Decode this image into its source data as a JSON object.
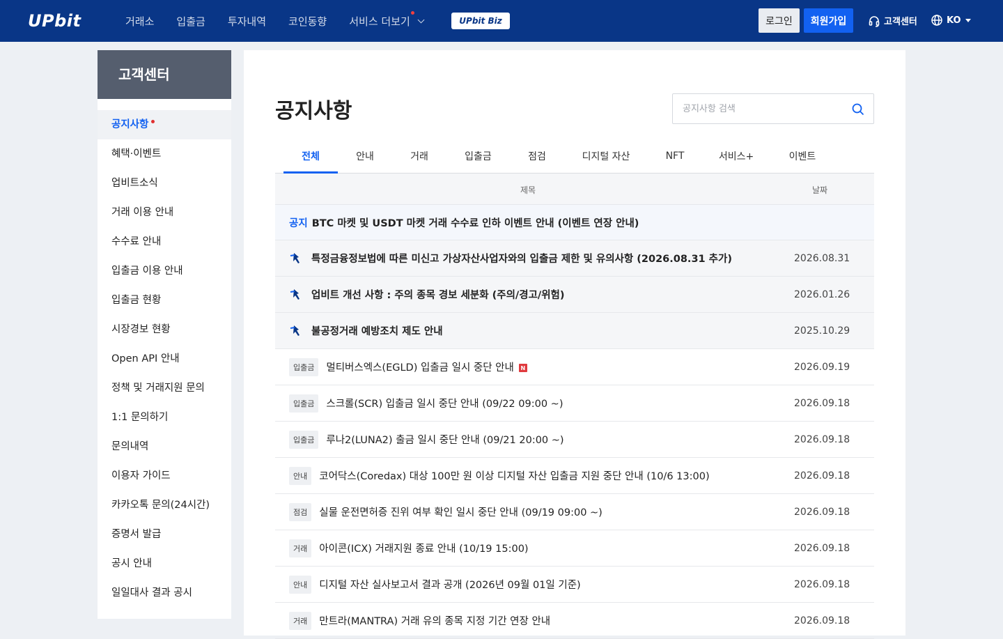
{
  "header": {
    "logo": "UPbit",
    "nav": [
      "거래소",
      "입출금",
      "투자내역",
      "코인동향"
    ],
    "nav_more": "서비스 더보기",
    "biz": "UPbit Biz",
    "login": "로그인",
    "join": "회원가입",
    "customer_center": "고객센터",
    "lang": "KO"
  },
  "sidebar": {
    "title": "고객센터",
    "items": [
      {
        "label": "공지사항",
        "active": true
      },
      {
        "label": "혜택·이벤트"
      },
      {
        "label": "업비트소식"
      },
      {
        "label": "거래 이용 안내"
      },
      {
        "label": "수수료 안내"
      },
      {
        "label": "입출금 이용 안내"
      },
      {
        "label": "입출금 현황"
      },
      {
        "label": "시장경보 현황"
      },
      {
        "label": "Open API 안내"
      },
      {
        "label": "정책 및 거래지원 문의"
      },
      {
        "label": "1:1 문의하기"
      },
      {
        "label": "문의내역"
      },
      {
        "label": "이용자 가이드"
      },
      {
        "label": "카카오톡 문의(24시간)"
      },
      {
        "label": "증명서 발급"
      },
      {
        "label": "공시 안내"
      },
      {
        "label": "일일대사 결과 공시"
      }
    ]
  },
  "main": {
    "title": "공지사항",
    "search_placeholder": "공지사항 검색",
    "tabs": [
      {
        "label": "전체",
        "active": true
      },
      {
        "label": "안내"
      },
      {
        "label": "거래"
      },
      {
        "label": "입출금"
      },
      {
        "label": "점검"
      },
      {
        "label": "디지털 자산"
      },
      {
        "label": "NFT"
      },
      {
        "label": "서비스+"
      },
      {
        "label": "이벤트"
      }
    ],
    "columns": {
      "title": "제목",
      "date": "날짜"
    },
    "notice": {
      "label": "공지",
      "title": "BTC 마켓 및 USDT 마켓 거래 수수료 인하 이벤트 안내 (이벤트 연장 안내)"
    },
    "pinned": [
      {
        "title": "특정금융정보법에 따른 미신고 가상자산사업자와의 입출금 제한 및 유의사항 (2026.08.31 추가)",
        "date": "2026.08.31"
      },
      {
        "title": "업비트 개선 사항 : 주의 종목 경보 세분화 (주의/경고/위험)",
        "date": "2026.01.26"
      },
      {
        "title": "불공정거래 예방조치 제도 안내",
        "date": "2025.10.29"
      }
    ],
    "rows": [
      {
        "category": "입출금",
        "title": "멀티버스엑스(EGLD) 입출금 일시 중단 안내",
        "date": "2026.09.19",
        "new": "N"
      },
      {
        "category": "입출금",
        "title": "스크롤(SCR) 입출금 일시 중단 안내 (09/22 09:00 ~)",
        "date": "2026.09.18"
      },
      {
        "category": "입출금",
        "title": "루나2(LUNA2) 출금 일시 중단 안내 (09/21 20:00 ~)",
        "date": "2026.09.18"
      },
      {
        "category": "안내",
        "title": "코어닥스(Coredax) 대상 100만 원 이상 디지털 자산 입출금 지원 중단 안내 (10/6 13:00)",
        "date": "2026.09.18"
      },
      {
        "category": "점검",
        "title": "실물 운전면허증 진위 여부 확인 일시 중단 안내 (09/19 09:00 ~)",
        "date": "2026.09.18"
      },
      {
        "category": "거래",
        "title": "아이콘(ICX) 거래지원 종료 안내 (10/19 15:00)",
        "date": "2026.09.18"
      },
      {
        "category": "안내",
        "title": "디지털 자산 실사보고서 결과 공개 (2026년 09월 01일 기준)",
        "date": "2026.09.18"
      },
      {
        "category": "거래",
        "title": "만트라(MANTRA) 거래 유의 종목 지정 기간 연장 안내",
        "date": "2026.09.18"
      }
    ]
  }
}
